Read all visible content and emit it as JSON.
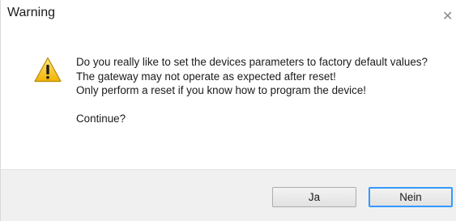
{
  "window": {
    "title": "Warning",
    "close_glyph": "✕"
  },
  "icon": {
    "name": "warning-icon",
    "colors": {
      "fill": "#f5c518",
      "edge": "#c89200",
      "mark": "#1a1a1a"
    }
  },
  "message": {
    "line1": "Do you really like to set the devices parameters to factory default values?",
    "line2": "The gateway may not operate as expected after reset!",
    "line3": "Only perform a reset if you know how to program the device!",
    "line4": "Continue?"
  },
  "buttons": {
    "yes_label": "Ja",
    "no_label": "Nein"
  }
}
